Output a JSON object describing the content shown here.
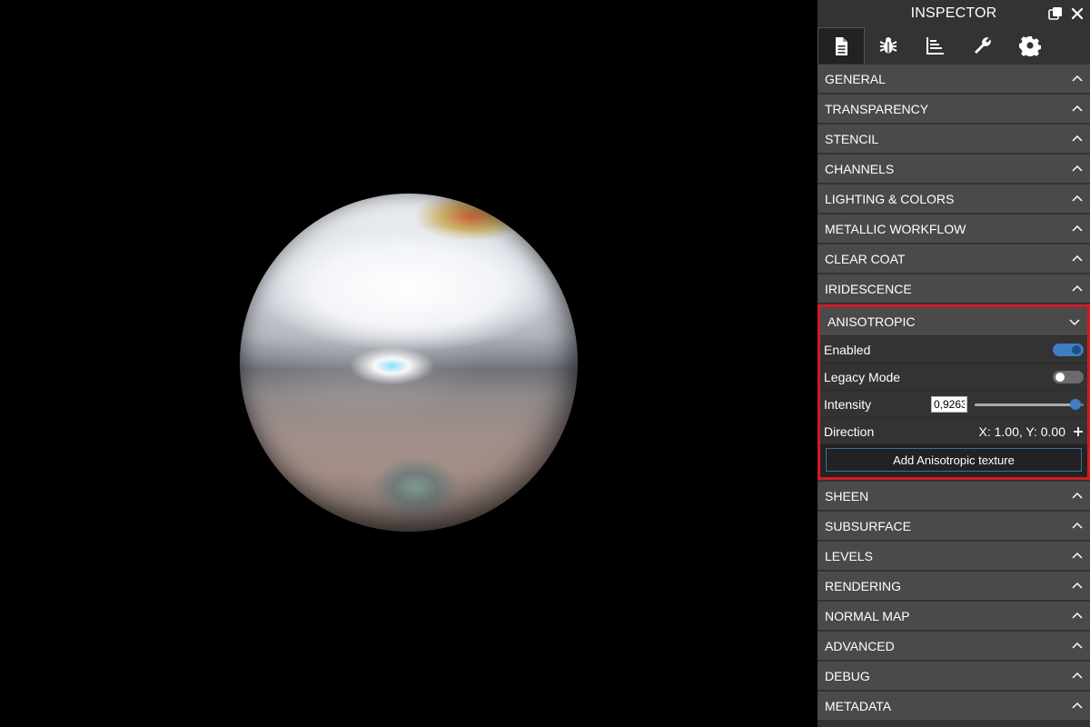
{
  "inspector": {
    "title": "INSPECTOR",
    "header_icons": [
      "popout-icon",
      "close-icon"
    ],
    "tabs": [
      {
        "name": "properties",
        "icon": "document-icon",
        "active": true
      },
      {
        "name": "debug",
        "icon": "bug-icon",
        "active": false
      },
      {
        "name": "statistics",
        "icon": "chart-icon",
        "active": false
      },
      {
        "name": "tools",
        "icon": "wrench-icon",
        "active": false
      },
      {
        "name": "settings",
        "icon": "gear-icon",
        "active": false
      }
    ],
    "sections": {
      "general": "GENERAL",
      "transparency": "TRANSPARENCY",
      "stencil": "STENCIL",
      "channels": "CHANNELS",
      "lighting_colors": "LIGHTING & COLORS",
      "metallic_workflow": "METALLIC WORKFLOW",
      "clear_coat": "CLEAR COAT",
      "iridescence": "IRIDESCENCE",
      "anisotropic": "ANISOTROPIC",
      "sheen": "SHEEN",
      "subsurface": "SUBSURFACE",
      "levels": "LEVELS",
      "rendering": "RENDERING",
      "normal_map": "NORMAL MAP",
      "advanced": "ADVANCED",
      "debug": "DEBUG",
      "metadata": "METADATA"
    },
    "anisotropic": {
      "enabled_label": "Enabled",
      "enabled": true,
      "legacy_label": "Legacy Mode",
      "legacy": false,
      "intensity_label": "Intensity",
      "intensity_value": "0,9263",
      "intensity_fraction": 0.9263,
      "direction_label": "Direction",
      "direction_value": "X: 1.00, Y: 0.00",
      "add_texture_label": "Add Anisotropic texture"
    },
    "colors": {
      "accent": "#3f7ec7",
      "highlight_border": "#d21c22",
      "panel_bg": "#333333",
      "section_bg": "#4a4a4a"
    }
  }
}
